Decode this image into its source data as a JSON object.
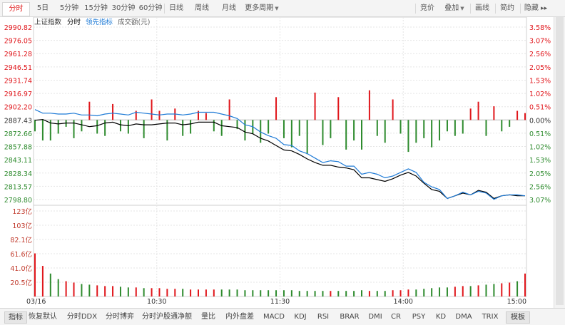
{
  "toolbar": {
    "periods": [
      {
        "label": "分时",
        "active": true
      },
      {
        "label": "5日"
      },
      {
        "label": "5分钟"
      },
      {
        "label": "15分钟"
      },
      {
        "label": "30分钟"
      },
      {
        "label": "60分钟"
      },
      {
        "label": "日线"
      },
      {
        "label": "周线"
      },
      {
        "label": "月线"
      },
      {
        "label": "更多周期"
      }
    ],
    "right_buttons": [
      "竞价",
      "叠加",
      "画线",
      "简约",
      "隐藏"
    ],
    "hide_arrows": "▸▸"
  },
  "legend": {
    "index_name": "上证指数",
    "series_main": "分时",
    "series_leading": "领先指标",
    "series_volume": "成交额(元)"
  },
  "colors": {
    "up": "#e0161b",
    "down": "#2e8b2e",
    "line_main": "#000000",
    "line_leading": "#1f7bd6",
    "grid": "#e5e5e5"
  },
  "chart_data": {
    "type": "line",
    "date": "03/16",
    "x_time_labels": [
      "10:30",
      "11:30",
      "14:00",
      "15:00"
    ],
    "price_axis": {
      "labels": [
        "2990.82",
        "2976.05",
        "2961.28",
        "2946.51",
        "2931.74",
        "2916.97",
        "2902.20",
        "2887.43",
        "2872.66",
        "2857.88",
        "2843.11",
        "2828.34",
        "2813.57",
        "2798.80"
      ],
      "min": 2798.8,
      "max": 2990.82,
      "prev_close": 2887.43
    },
    "pct_axis": {
      "labels": [
        "3.58%",
        "3.07%",
        "2.56%",
        "2.05%",
        "1.53%",
        "1.02%",
        "0.51%",
        "0.00%",
        "0.51%",
        "1.02%",
        "1.53%",
        "2.05%",
        "2.56%",
        "3.07%"
      ]
    },
    "volume_axis": {
      "labels": [
        "123亿",
        "103亿",
        "82.1亿",
        "61.6亿",
        "41.0亿",
        "20.5亿"
      ],
      "max": 123
    },
    "series": [
      {
        "name": "分时",
        "key": "main",
        "values": [
          2887,
          2888,
          2884,
          2883,
          2884,
          2884,
          2882,
          2880,
          2881,
          2884,
          2885,
          2882,
          2881,
          2883,
          2882,
          2882,
          2883,
          2884,
          2884,
          2882,
          2883,
          2885,
          2885,
          2885,
          2881,
          2880,
          2879,
          2874,
          2872,
          2867,
          2864,
          2859,
          2854,
          2853,
          2849,
          2844,
          2840,
          2837,
          2837,
          2835,
          2834,
          2832,
          2823,
          2823,
          2821,
          2819,
          2822,
          2826,
          2829,
          2825,
          2817,
          2810,
          2808,
          2800,
          2803,
          2806,
          2804,
          2809,
          2807,
          2800,
          2803,
          2804,
          2803,
          2803
        ]
      },
      {
        "name": "领先指标",
        "key": "leading",
        "values": [
          2899,
          2895,
          2895,
          2894,
          2894,
          2895,
          2893,
          2893,
          2892,
          2894,
          2895,
          2894,
          2893,
          2896,
          2895,
          2894,
          2893,
          2894,
          2894,
          2893,
          2894,
          2896,
          2896,
          2896,
          2894,
          2892,
          2889,
          2882,
          2880,
          2874,
          2870,
          2867,
          2860,
          2859,
          2853,
          2850,
          2845,
          2840,
          2842,
          2841,
          2836,
          2836,
          2827,
          2829,
          2827,
          2823,
          2825,
          2829,
          2833,
          2829,
          2818,
          2813,
          2810,
          2800,
          2803,
          2807,
          2804,
          2808,
          2806,
          2799,
          2803,
          2804,
          2804,
          2803
        ]
      }
    ],
    "indicator_bars": [
      -5,
      -9,
      -9,
      -6,
      -3,
      -8,
      -5,
      8,
      -6,
      -7,
      7,
      -5,
      -6,
      4,
      -8,
      9,
      4,
      -9,
      5,
      -7,
      -6,
      4,
      3,
      -5,
      -7,
      9,
      -4,
      -9,
      -6,
      -10,
      -6,
      10,
      -8,
      -12,
      -7,
      -15,
      12,
      -11,
      -8,
      10,
      -13,
      -9,
      -13,
      13,
      -7,
      -10,
      9,
      -6,
      -14,
      -10,
      -8,
      -12,
      -9,
      -5,
      -7,
      -6,
      5,
      8,
      -7,
      6,
      -5,
      -3,
      4,
      3
    ],
    "volume": [
      62,
      44,
      33,
      25,
      22,
      20,
      18,
      17,
      16,
      15,
      15,
      14,
      13,
      13,
      12,
      12,
      12,
      11,
      11,
      11,
      10,
      10,
      10,
      10,
      10,
      10,
      10,
      9,
      9,
      9,
      9,
      9,
      9,
      9,
      8,
      8,
      8,
      8,
      8,
      8,
      8,
      8,
      9,
      8,
      8,
      8,
      9,
      9,
      10,
      10,
      11,
      12,
      13,
      13,
      14,
      15,
      15,
      16,
      17,
      18,
      19,
      20,
      22,
      33
    ]
  },
  "bottom_tabs": [
    {
      "label": "指标",
      "active": true
    },
    {
      "label": "恢复默认"
    },
    {
      "label": "分时DDX"
    },
    {
      "label": "分时博弈"
    },
    {
      "label": "分时沪股通净额"
    },
    {
      "label": "量比"
    },
    {
      "label": "内外盘差"
    },
    {
      "label": "MACD"
    },
    {
      "label": "KDJ"
    },
    {
      "label": "RSI"
    },
    {
      "label": "BRAR"
    },
    {
      "label": "DMI"
    },
    {
      "label": "CR"
    },
    {
      "label": "PSY"
    },
    {
      "label": "KD"
    },
    {
      "label": "DMA"
    },
    {
      "label": "TRIX"
    },
    {
      "label": "模板",
      "active": true
    }
  ]
}
